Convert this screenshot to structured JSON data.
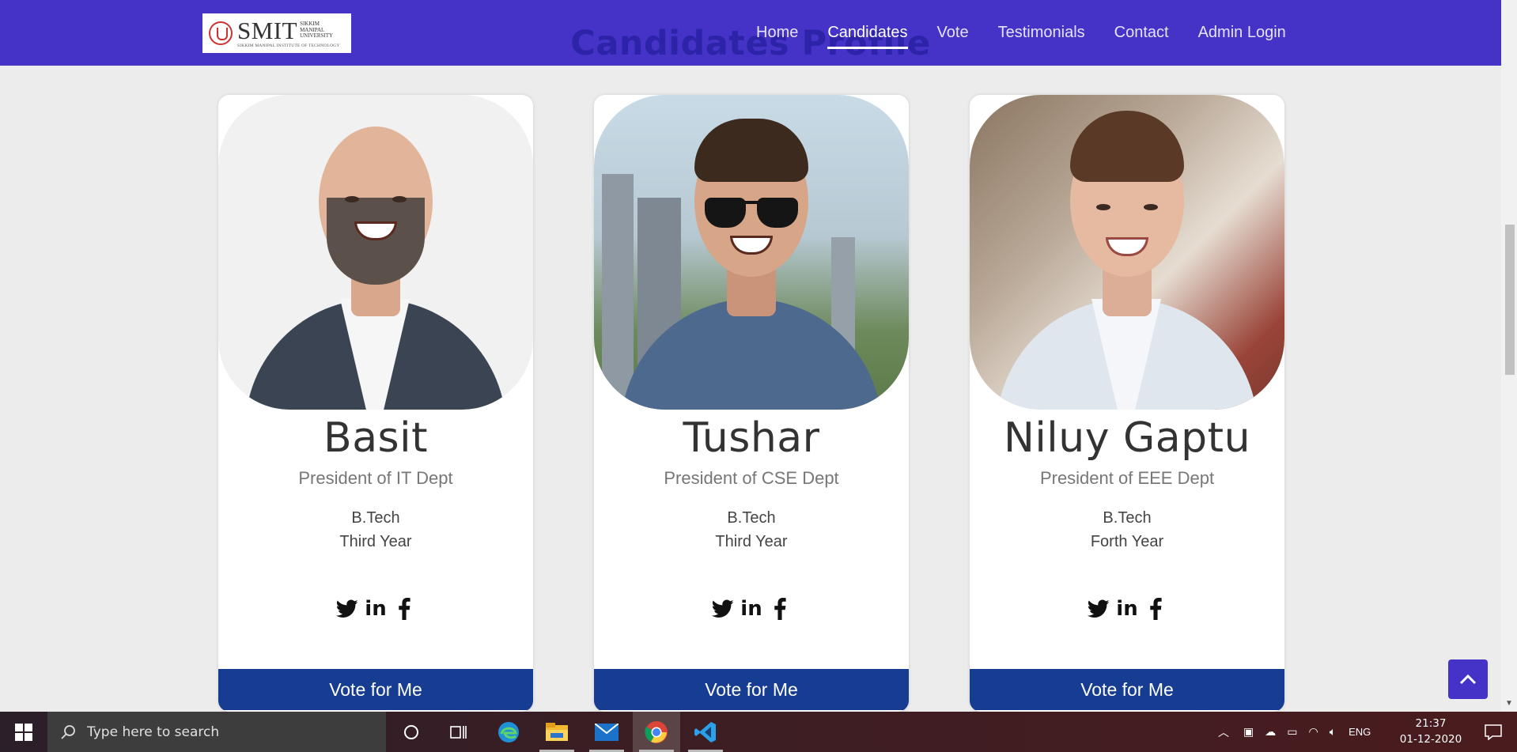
{
  "nav": {
    "logo_name": "SMIT",
    "logo_university": [
      "SIKKIM",
      "MANIPAL",
      "UNIVERSITY"
    ],
    "logo_subtitle": "SIKKIM MANIPAL INSTITUTE OF TECHNOLOGY",
    "links": [
      "Home",
      "Candidates",
      "Vote",
      "Testimonials",
      "Contact",
      "Admin Login"
    ],
    "active": "Candidates"
  },
  "section_heading": "Candidates Profile",
  "candidates": [
    {
      "name": "Basit",
      "role": "President of IT Dept",
      "degree": "B.Tech",
      "year": "Third Year",
      "vote_label": "Vote for Me"
    },
    {
      "name": "Tushar",
      "role": "President of CSE Dept",
      "degree": "B.Tech",
      "year": "Third Year",
      "vote_label": "Vote for Me"
    },
    {
      "name": "Niluy Gaptu",
      "role": "President of EEE Dept",
      "degree": "B.Tech",
      "year": "Forth Year",
      "vote_label": "Vote for Me"
    }
  ],
  "social_icons": [
    "twitter-icon",
    "linkedin-icon",
    "facebook-icon"
  ],
  "taskbar": {
    "search_placeholder": "Type here to search",
    "apps": [
      "cortana-icon",
      "task-view-icon",
      "edge-icon",
      "file-explorer-icon",
      "mail-icon",
      "chrome-icon",
      "vscode-icon"
    ],
    "language": "ENG",
    "time": "21:37",
    "date": "01-12-2020"
  },
  "colors": {
    "navbar": "#4433c6",
    "vote_button": "#173d92",
    "page_bg": "#ececec"
  }
}
